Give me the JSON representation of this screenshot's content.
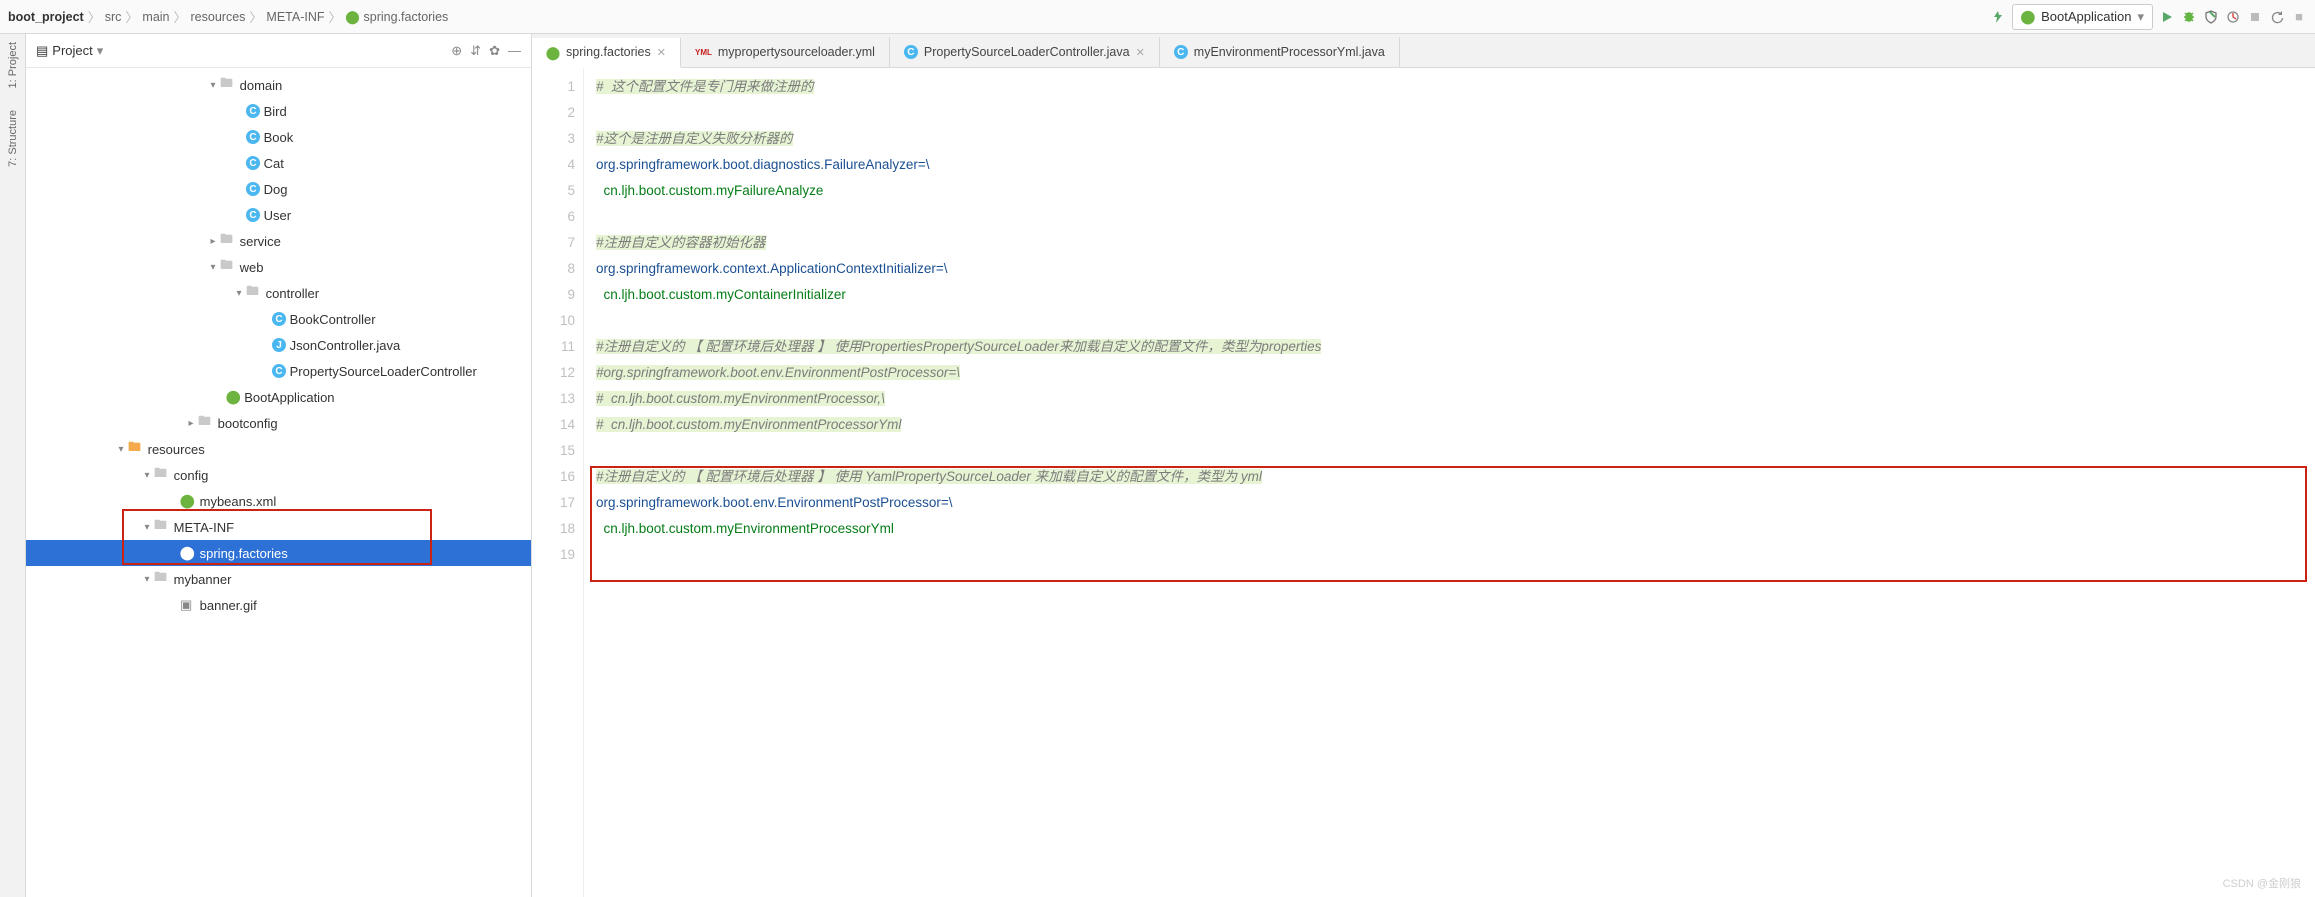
{
  "breadcrumbs": {
    "project": "boot_project",
    "parts": [
      "src",
      "main",
      "resources",
      "META-INF",
      "spring.factories"
    ]
  },
  "run_config": {
    "label": "BootApplication"
  },
  "sidetools": {
    "project": "1: Project",
    "structure": "7: Structure"
  },
  "panel": {
    "title": "Project"
  },
  "tree": {
    "domain": "domain",
    "bird": "Bird",
    "book": "Book",
    "cat": "Cat",
    "dog": "Dog",
    "user": "User",
    "service": "service",
    "web": "web",
    "controller": "controller",
    "book_ctrl": "BookController",
    "json_ctrl": "JsonController.java",
    "psl_ctrl": "PropertySourceLoaderController",
    "boot_app": "BootApplication",
    "bootconfig": "bootconfig",
    "resources": "resources",
    "config": "config",
    "mybeans": "mybeans.xml",
    "metainf": "META-INF",
    "springfactories": "spring.factories",
    "mybanner": "mybanner",
    "bannergif": "banner.gif"
  },
  "tabs": [
    {
      "label": "spring.factories",
      "icon": "spring",
      "close": true,
      "active": true
    },
    {
      "label": "mypropertysourceloader.yml",
      "icon": "yml",
      "close": false,
      "active": false
    },
    {
      "label": "PropertySourceLoaderController.java",
      "icon": "class",
      "close": true,
      "active": false
    },
    {
      "label": "myEnvironmentProcessorYml.java",
      "icon": "class",
      "close": false,
      "active": false
    }
  ],
  "code_lines": [
    {
      "n": 1,
      "cls": "hl-comment",
      "txt": "#  这个配置文件是专门用来做注册的"
    },
    {
      "n": 2,
      "cls": "",
      "txt": ""
    },
    {
      "n": 3,
      "cls": "hl-comment",
      "txt": "#这个是注册自定义失败分析器的"
    },
    {
      "n": 4,
      "cls": "ident",
      "txt": "org.springframework.boot.diagnostics.FailureAnalyzer=\\"
    },
    {
      "n": 5,
      "cls": "str",
      "txt": "  cn.ljh.boot.custom.myFailureAnalyze"
    },
    {
      "n": 6,
      "cls": "",
      "txt": ""
    },
    {
      "n": 7,
      "cls": "hl-comment",
      "txt": "#注册自定义的容器初始化器"
    },
    {
      "n": 8,
      "cls": "ident",
      "txt": "org.springframework.context.ApplicationContextInitializer=\\"
    },
    {
      "n": 9,
      "cls": "str",
      "txt": "  cn.ljh.boot.custom.myContainerInitializer"
    },
    {
      "n": 10,
      "cls": "",
      "txt": ""
    },
    {
      "n": 11,
      "cls": "hl-comment",
      "txt": "#注册自定义的 【 配置环境后处理器 】 使用PropertiesPropertySourceLoader来加载自定义的配置文件，类型为properties"
    },
    {
      "n": 12,
      "cls": "hl-comment",
      "txt": "#org.springframework.boot.env.EnvironmentPostProcessor=\\"
    },
    {
      "n": 13,
      "cls": "hl-comment",
      "txt": "#  cn.ljh.boot.custom.myEnvironmentProcessor,\\"
    },
    {
      "n": 14,
      "cls": "hl-comment",
      "txt": "#  cn.ljh.boot.custom.myEnvironmentProcessorYml"
    },
    {
      "n": 15,
      "cls": "",
      "txt": ""
    },
    {
      "n": 16,
      "cls": "hl-comment",
      "txt": "#注册自定义的 【 配置环境后处理器 】 使用 YamlPropertySourceLoader 来加载自定义的配置文件，类型为 yml"
    },
    {
      "n": 17,
      "cls": "ident",
      "txt": "org.springframework.boot.env.EnvironmentPostProcessor=\\"
    },
    {
      "n": 18,
      "cls": "str",
      "txt": "  cn.ljh.boot.custom.myEnvironmentProcessorYml"
    },
    {
      "n": 19,
      "cls": "",
      "txt": ""
    }
  ],
  "watermark": "CSDN @金刚狼"
}
